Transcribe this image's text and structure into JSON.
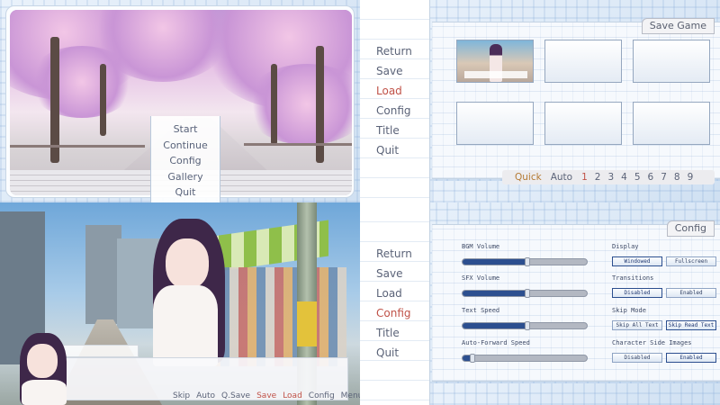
{
  "main_menu": {
    "items": [
      "Start",
      "Continue",
      "Config",
      "Gallery",
      "Quit"
    ]
  },
  "save_screen": {
    "nav": [
      {
        "label": "Return",
        "active": false
      },
      {
        "label": "Save",
        "active": false
      },
      {
        "label": "Load",
        "active": true
      },
      {
        "label": "Config",
        "active": false
      },
      {
        "label": "Title",
        "active": false
      },
      {
        "label": "Quit",
        "active": false
      }
    ],
    "title": "Save Game",
    "slots_filled": [
      true,
      false,
      false,
      false,
      false,
      false
    ],
    "pager": {
      "quick": "Quick",
      "auto": "Auto",
      "pages": [
        "1",
        "2",
        "3",
        "4",
        "5",
        "6",
        "7",
        "8",
        "9"
      ],
      "current_page": "1"
    }
  },
  "game_screen": {
    "quick_menu": [
      {
        "label": "Skip",
        "highlight": false
      },
      {
        "label": "Auto",
        "highlight": false
      },
      {
        "label": "Q.Save",
        "highlight": false
      },
      {
        "label": "Save",
        "highlight": true
      },
      {
        "label": "Load",
        "highlight": true
      },
      {
        "label": "Config",
        "highlight": false
      },
      {
        "label": "Menu",
        "highlight": false
      }
    ]
  },
  "config_screen": {
    "nav": [
      {
        "label": "Return",
        "active": false
      },
      {
        "label": "Save",
        "active": false
      },
      {
        "label": "Load",
        "active": false
      },
      {
        "label": "Config",
        "active": true
      },
      {
        "label": "Title",
        "active": false
      },
      {
        "label": "Quit",
        "active": false
      }
    ],
    "title": "Config",
    "sliders": [
      {
        "label": "BGM Volume",
        "value": 0.52
      },
      {
        "label": "SFX Volume",
        "value": 0.52
      },
      {
        "label": "Text Speed",
        "value": 0.52
      },
      {
        "label": "Auto-Forward Speed",
        "value": 0.08
      }
    ],
    "options": [
      {
        "label": "Display",
        "choices": [
          "Windowed",
          "Fullscreen"
        ],
        "selected": 0
      },
      {
        "label": "Transitions",
        "choices": [
          "Disabled",
          "Enabled"
        ],
        "selected": 0
      },
      {
        "label": "Skip Mode",
        "choices": [
          "Skip All Text",
          "Skip Read Text"
        ],
        "selected": 1
      },
      {
        "label": "Character Side Images",
        "choices": [
          "Disabled",
          "Enabled"
        ],
        "selected": 1
      }
    ]
  },
  "colors": {
    "accent_red": "#c05248",
    "menu_text": "#5b6378",
    "slider_fill": "#2c4f8f"
  }
}
